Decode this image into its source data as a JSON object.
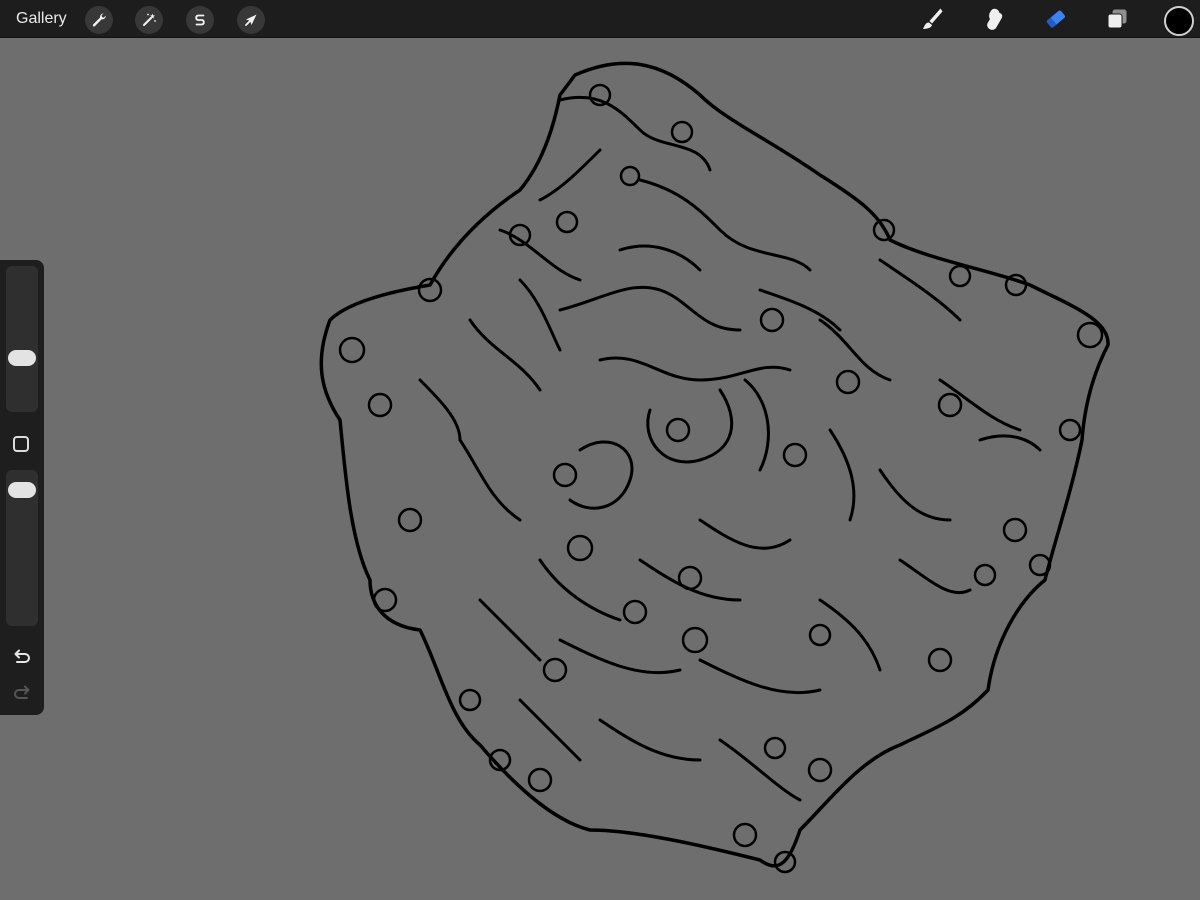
{
  "toolbar": {
    "gallery_label": "Gallery",
    "left_tools": [
      {
        "name": "actions",
        "icon": "wrench-icon"
      },
      {
        "name": "adjustments",
        "icon": "magic-wand-icon"
      },
      {
        "name": "selection",
        "icon": "selection-s-icon"
      },
      {
        "name": "transform",
        "icon": "arrow-cursor-icon"
      }
    ],
    "right_tools": [
      {
        "name": "brush",
        "icon": "brush-icon",
        "active": false
      },
      {
        "name": "smudge",
        "icon": "smudge-icon",
        "active": false
      },
      {
        "name": "eraser",
        "icon": "eraser-icon",
        "active": true
      },
      {
        "name": "layers",
        "icon": "layers-icon",
        "active": false
      }
    ],
    "current_color": "#000000"
  },
  "sidebar": {
    "brush_size_level": 0.35,
    "opacity_level": 0.93,
    "icons": [
      "modify-square-icon",
      "undo-icon",
      "redo-icon"
    ]
  },
  "colors": {
    "toolbar_bg": "#1d1d1d",
    "canvas_bg": "#6e6e6e",
    "accent": "#3b82f6",
    "stroke": "#000000"
  }
}
